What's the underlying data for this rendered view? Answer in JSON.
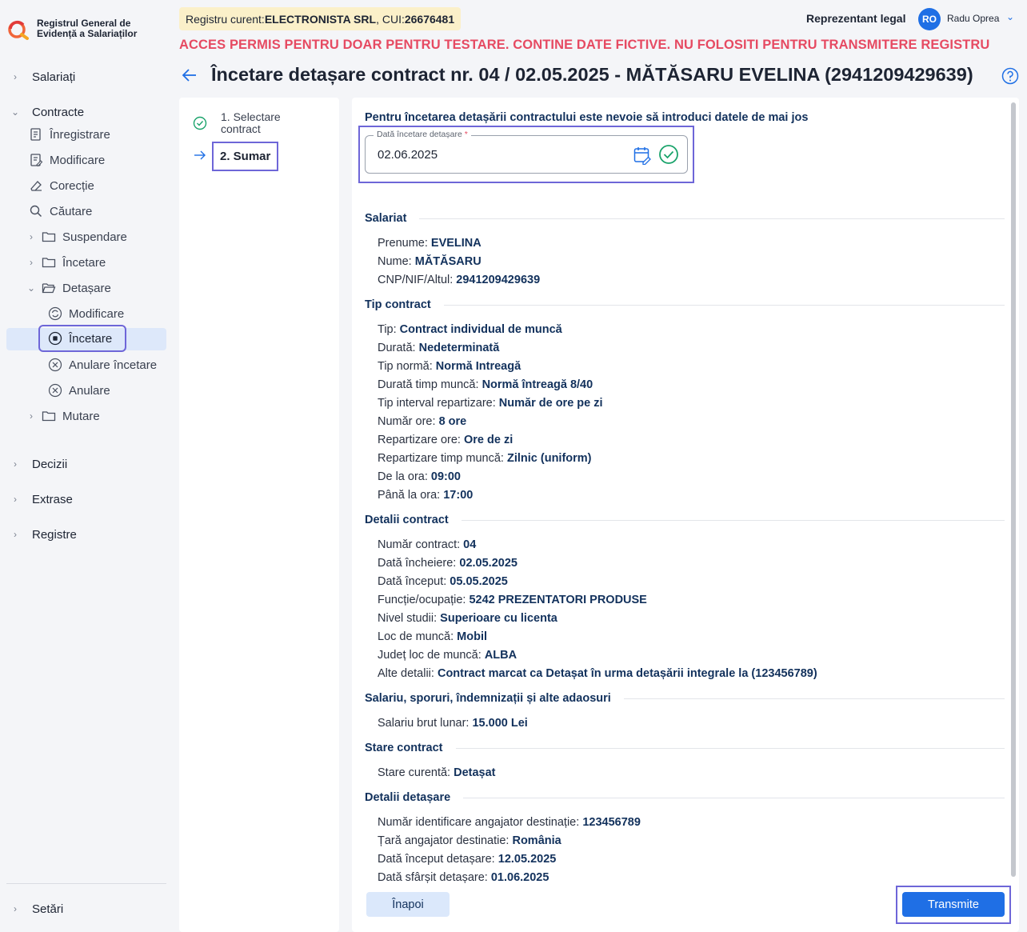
{
  "app": {
    "logo_line1": "Registrul General de",
    "logo_line2": "Evidență a Salariaților"
  },
  "header": {
    "registry_prefix": "Registru curent: ",
    "registry_company": "ELECTRONISTA SRL",
    "registry_cui_prefix": ", CUI: ",
    "registry_cui": "26676481",
    "role": "Reprezentant legal",
    "avatar_initials": "RO",
    "user_name": "Radu Oprea",
    "warning": "ACCES PERMIS PENTRU DOAR PENTRU TESTARE. CONTINE DATE FICTIVE. NU FOLOSITI PENTRU TRANSMITERE REGISTRU"
  },
  "page": {
    "title": "Încetare detașare contract nr. 04 / 02.05.2025 - MĂTĂSARU  EVELINA (2941209429639)"
  },
  "sidebar": {
    "salariati": "Salariați",
    "contracte": "Contracte",
    "inregistrare": "Înregistrare",
    "modificare": "Modificare",
    "corectie": "Corecție",
    "cautare": "Căutare",
    "suspendare": "Suspendare",
    "incetare": "Încetare",
    "detasare": "Detașare",
    "det_modificare": "Modificare",
    "det_incetare": "Încetare",
    "det_anulare_incetare": "Anulare încetare",
    "det_anulare": "Anulare",
    "mutare": "Mutare",
    "decizii": "Decizii",
    "extrase": "Extrase",
    "registre": "Registre",
    "setari": "Setări"
  },
  "stepper": {
    "step1": "1. Selectare contract",
    "step2": "2. Sumar"
  },
  "form": {
    "intro": "Pentru încetarea detașării contractului este nevoie să introduci datele de mai jos",
    "date_label": "Dată încetare detașare",
    "date_required": "*",
    "date_value": "02.06.2025"
  },
  "summary": {
    "salariat": {
      "title": "Salariat",
      "prenume_label": "Prenume: ",
      "prenume": "EVELINA",
      "nume_label": "Nume: ",
      "nume": "MĂTĂSARU",
      "cnp_label": "CNP/NIF/Altul: ",
      "cnp": "2941209429639"
    },
    "tip_contract": {
      "title": "Tip contract",
      "tip_label": "Tip: ",
      "tip": "Contract individual de muncă",
      "durata_label": "Durată: ",
      "durata": "Nedeterminată",
      "tip_norma_label": "Tip normă: ",
      "tip_norma": "Normă Intreagă",
      "durata_timp_label": "Durată timp muncă: ",
      "durata_timp": "Normă întreagă 8/40",
      "tip_interval_label": "Tip interval repartizare: ",
      "tip_interval": "Număr de ore pe zi",
      "numar_ore_label": "Număr ore: ",
      "numar_ore": "8 ore",
      "repartizare_ore_label": "Repartizare ore: ",
      "repartizare_ore": "Ore de zi",
      "repartizare_timp_label": "Repartizare timp muncă: ",
      "repartizare_timp": "Zilnic (uniform)",
      "de_la_label": "De la ora: ",
      "de_la": "09:00",
      "pana_la_label": "Până la ora: ",
      "pana_la": "17:00"
    },
    "detalii_contract": {
      "title": "Detalii contract",
      "numar_label": "Număr contract: ",
      "numar": "04",
      "data_incheiere_label": "Dată încheiere: ",
      "data_incheiere": "02.05.2025",
      "data_inceput_label": "Dată început: ",
      "data_inceput": "05.05.2025",
      "functie_label": "Funcție/ocupație: ",
      "functie": "5242 PREZENTATORI PRODUSE",
      "nivel_studii_label": "Nivel studii: ",
      "nivel_studii": "Superioare cu licenta",
      "loc_munca_label": "Loc de muncă: ",
      "loc_munca": "Mobil",
      "judet_label": "Județ loc de muncă: ",
      "judet": "ALBA",
      "alte_label": "Alte detalii: ",
      "alte": "Contract marcat ca Detașat în urma detașării integrale la (123456789)"
    },
    "salariu": {
      "title": "Salariu, sporuri, îndemnizații și alte adaosuri",
      "brut_label": "Salariu brut lunar: ",
      "brut": "15.000 Lei"
    },
    "stare": {
      "title": "Stare contract",
      "curenta_label": "Stare curentă: ",
      "curenta": "Detașat"
    },
    "detasare": {
      "title": "Detalii detașare",
      "nr_id_label": "Număr identificare angajator destinație: ",
      "nr_id": "123456789",
      "tara_label": "Țară angajator destinatie: ",
      "tara": "România",
      "inceput_label": "Dată început detașare: ",
      "inceput": "12.05.2025",
      "sfarsit_label": "Dată sfârșit detașare: ",
      "sfarsit": "01.06.2025"
    }
  },
  "actions": {
    "back": "Înapoi",
    "submit": "Transmite"
  },
  "colors": {
    "accent": "#1f6fe5",
    "warning": "#e64a62",
    "highlight": "#6e66d8",
    "success": "#1aa36b"
  }
}
